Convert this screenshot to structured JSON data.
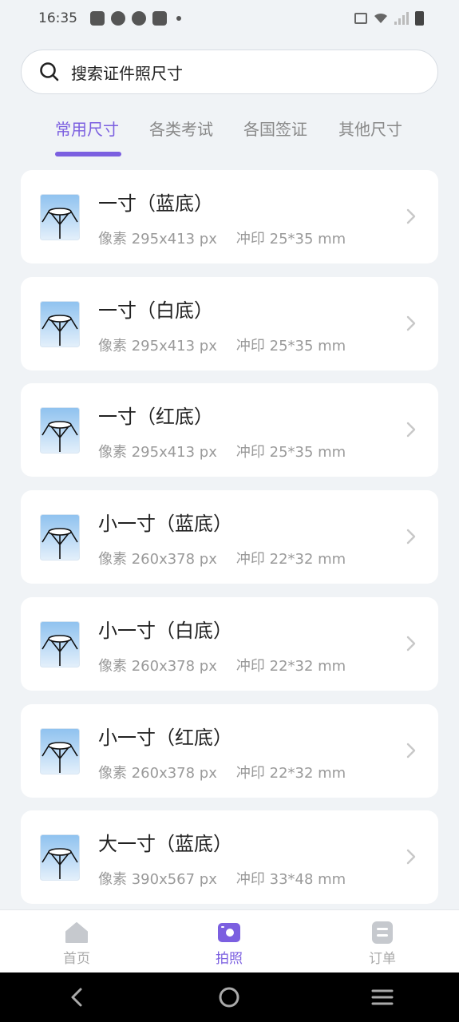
{
  "status_bar": {
    "time": "16:35"
  },
  "search": {
    "placeholder": "搜索证件照尺寸"
  },
  "tabs": [
    {
      "label": "常用尺寸",
      "active": true
    },
    {
      "label": "各类考试",
      "active": false
    },
    {
      "label": "各国签证",
      "active": false
    },
    {
      "label": "其他尺寸",
      "active": false
    }
  ],
  "items": [
    {
      "title": "一寸（蓝底）",
      "pixels": "像素 295x413 px",
      "print": "冲印 25*35 mm"
    },
    {
      "title": "一寸（白底）",
      "pixels": "像素 295x413 px",
      "print": "冲印 25*35 mm"
    },
    {
      "title": "一寸（红底）",
      "pixels": "像素 295x413 px",
      "print": "冲印 25*35 mm"
    },
    {
      "title": "小一寸（蓝底）",
      "pixels": "像素 260x378 px",
      "print": "冲印 22*32 mm"
    },
    {
      "title": "小一寸（白底）",
      "pixels": "像素 260x378 px",
      "print": "冲印 22*32 mm"
    },
    {
      "title": "小一寸（红底）",
      "pixels": "像素 260x378 px",
      "print": "冲印 22*32 mm"
    },
    {
      "title": "大一寸（蓝底）",
      "pixels": "像素 390x567 px",
      "print": "冲印 33*48 mm"
    }
  ],
  "bottom_nav": [
    {
      "label": "首页",
      "icon": "home-icon",
      "active": false
    },
    {
      "label": "拍照",
      "icon": "camera-icon",
      "active": true
    },
    {
      "label": "订单",
      "icon": "order-icon",
      "active": false
    }
  ],
  "colors": {
    "accent": "#7b5fe0",
    "background": "#f0f3f6",
    "muted": "#9a9a9a"
  }
}
